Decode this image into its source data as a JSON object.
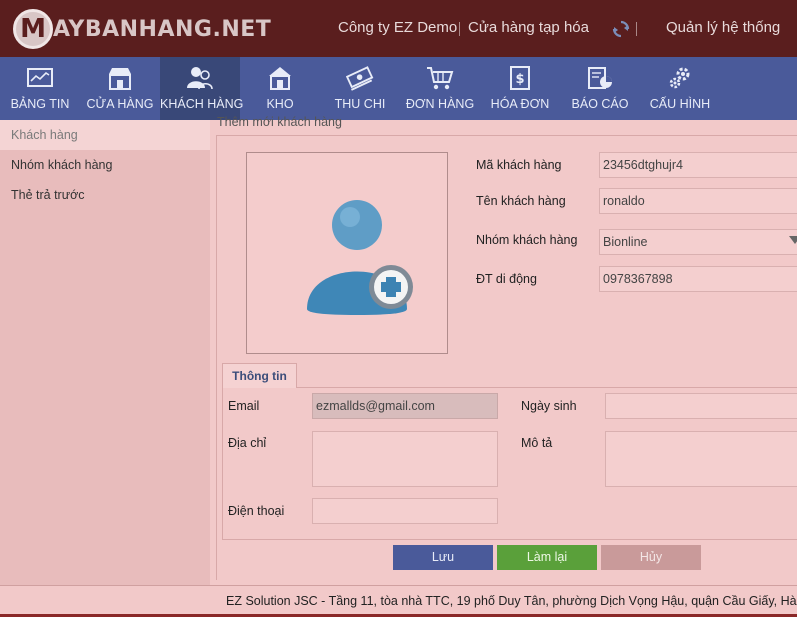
{
  "header": {
    "logo_letter": "M",
    "logo_text": "AYBANHANG.NET",
    "company": "Công ty EZ Demo",
    "store": "Cửa hàng tạp hóa",
    "admin": "Quản lý hệ thống"
  },
  "nav": {
    "items": [
      {
        "label": "BẢNG TIN",
        "icon": "dashboard-icon"
      },
      {
        "label": "CỬA HÀNG",
        "icon": "store-icon"
      },
      {
        "label": "KHÁCH HÀNG",
        "icon": "customers-icon"
      },
      {
        "label": "KHO",
        "icon": "warehouse-icon"
      },
      {
        "label": "THU CHI",
        "icon": "money-icon"
      },
      {
        "label": "ĐƠN HÀNG",
        "icon": "cart-icon"
      },
      {
        "label": "HÓA ĐƠN",
        "icon": "invoice-icon"
      },
      {
        "label": "BÁO CÁO",
        "icon": "report-icon"
      },
      {
        "label": "CẤU HÌNH",
        "icon": "settings-icon"
      }
    ],
    "active_index": 2
  },
  "sidebar": {
    "items": [
      {
        "label": "Khách hàng"
      },
      {
        "label": "Nhóm khách hàng"
      },
      {
        "label": "Thẻ trả trước"
      }
    ]
  },
  "main": {
    "title": "Thêm mới khách hàng"
  },
  "form": {
    "code_label": "Mã khách hàng",
    "code_value": "23456dtghujr4",
    "name_label": "Tên khách hàng",
    "name_value": "ronaldo",
    "group_label": "Nhóm khách hàng",
    "group_value": "Bionline",
    "mobile_label": "ĐT di động",
    "mobile_value": "0978367898"
  },
  "info_tab": {
    "tab_label": "Thông tin",
    "email_label": "Email",
    "email_value": "ezmallds@gmail.com",
    "birthday_label": "Ngày sinh",
    "birthday_value": "",
    "address_label": "Địa chỉ",
    "address_value": "",
    "desc_label": "Mô tả",
    "desc_value": "",
    "phone_label": "Điện thoại",
    "phone_value": ""
  },
  "buttons": {
    "save": "Lưu",
    "reset": "Làm lại",
    "cancel": "Hủy"
  },
  "footer": {
    "text": "EZ Solution JSC - Tầng 11, tòa nhà TTC, 19 phố Duy Tân, phường Dịch Vọng Hậu, quận Cầu Giấy, Hà Nội"
  },
  "colors": {
    "header_bg": "#5a1e1e",
    "nav_bg": "#4a5a9a",
    "page_bg": "#f2c9c9",
    "save_btn": "#4a5a9a",
    "reset_btn": "#5aa03a",
    "cancel_btn": "#c99a9a"
  }
}
